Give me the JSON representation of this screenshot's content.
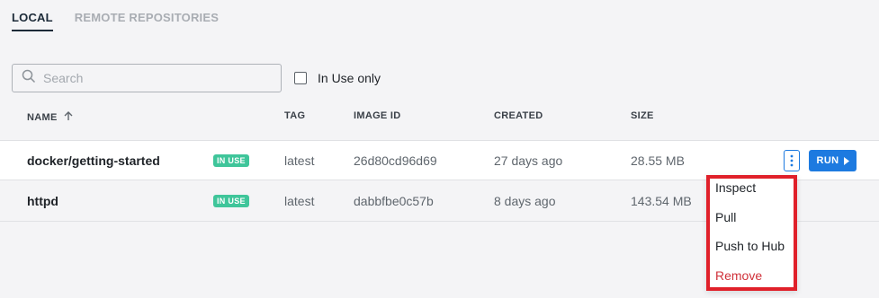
{
  "tabs": [
    {
      "label": "LOCAL",
      "active": true
    },
    {
      "label": "REMOTE REPOSITORIES",
      "active": false
    }
  ],
  "search": {
    "placeholder": "Search",
    "value": ""
  },
  "filter": {
    "label": "In Use only",
    "checked": false
  },
  "columns": {
    "name": "NAME",
    "tag": "TAG",
    "image_id": "IMAGE ID",
    "created": "CREATED",
    "size": "SIZE"
  },
  "rows": [
    {
      "name": "docker/getting-started",
      "badge": "IN USE",
      "tag": "latest",
      "image_id": "26d80cd96d69",
      "created": "27 days ago",
      "size": "28.55 MB"
    },
    {
      "name": "httpd",
      "badge": "IN USE",
      "tag": "latest",
      "image_id": "dabbfbe0c57b",
      "created": "8 days ago",
      "size": "143.54 MB"
    }
  ],
  "actions": {
    "run_label": "RUN"
  },
  "context_menu": {
    "items": [
      "Inspect",
      "Pull",
      "Push to Hub",
      "Remove"
    ]
  },
  "colors": {
    "accent": "#1d7ae0",
    "badge": "#3fc59a",
    "danger": "#d0313a",
    "highlight_border": "#e0202a"
  }
}
